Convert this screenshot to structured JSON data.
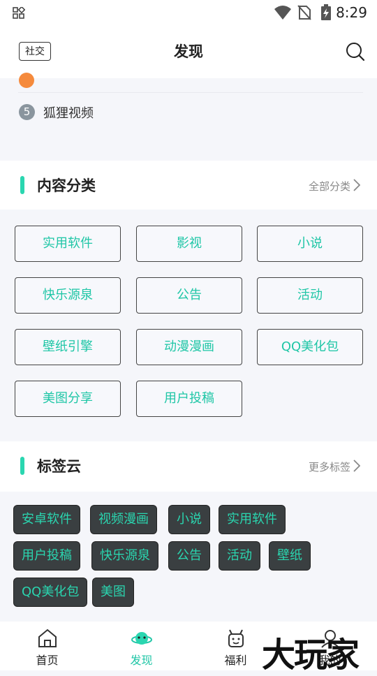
{
  "status_bar": {
    "time": "8:29"
  },
  "app_bar": {
    "social_label": "社交",
    "title": "发现"
  },
  "ranking": {
    "item5_number": "5",
    "item5_title": "狐狸视频"
  },
  "categories": {
    "title": "内容分类",
    "more": "全部分类",
    "items": [
      "实用软件",
      "影视",
      "小说",
      "快乐源泉",
      "公告",
      "活动",
      "壁纸引擎",
      "动漫漫画",
      "QQ美化包",
      "美图分享",
      "用户投稿"
    ]
  },
  "tags": {
    "title": "标签云",
    "more": "更多标签",
    "items": [
      "安卓软件",
      "视频漫画",
      "小说",
      "实用软件",
      "用户投稿",
      "快乐源泉",
      "公告",
      "活动",
      "壁纸",
      "QQ美化包",
      "美图"
    ]
  },
  "tab_bar": {
    "items": [
      "首页",
      "发现",
      "福利",
      "我的"
    ],
    "active": "发现"
  },
  "watermark": "大玩家",
  "colors": {
    "accent": "#2ad6b0",
    "tag_bg": "#3a3f41",
    "rank_orange": "#f58a3c"
  }
}
